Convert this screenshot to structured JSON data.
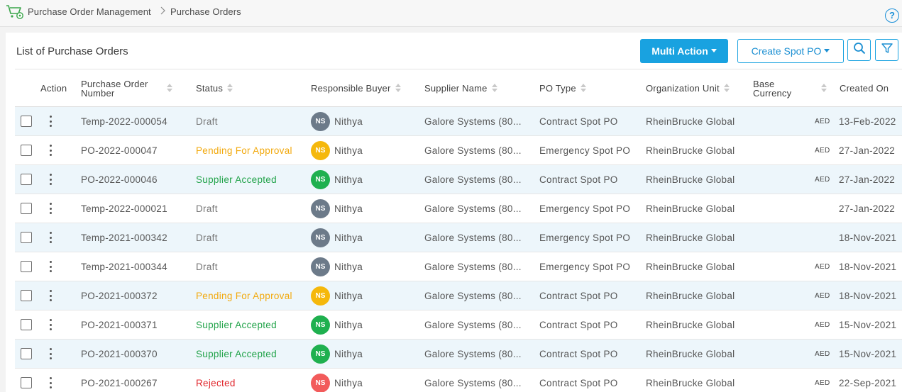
{
  "breadcrumb": {
    "root": "Purchase Order Management",
    "current": "Purchase Orders"
  },
  "help_label": "?",
  "panel": {
    "title": "List of Purchase Orders"
  },
  "toolbar": {
    "multi_action_label": "Multi Action",
    "create_spot_po_label": "Create Spot PO"
  },
  "colors": {
    "accent": "#19a2e0",
    "status_draft": "#777777",
    "status_pending": "#f2a90d",
    "status_accepted": "#22a34a",
    "status_rejected": "#e0252b",
    "avatar_gray": "#6c7a89",
    "avatar_yellow": "#f5b80c",
    "avatar_green": "#1fb04f",
    "avatar_red": "#f25b5b"
  },
  "table": {
    "columns": {
      "action": "Action",
      "po_number_line1": "Purchase Order",
      "po_number_line2": "Number",
      "status": "Status",
      "buyer": "Responsible Buyer",
      "supplier": "Supplier Name",
      "po_type": "PO Type",
      "org_unit": "Organization Unit",
      "base_currency_line1": "Base",
      "base_currency_line2": "Currency",
      "created_on": "Created On"
    },
    "rows": [
      {
        "po_number": "Temp-2022-000054",
        "status": "Draft",
        "status_kind": "draft",
        "buyer_initials": "NS",
        "buyer_name": "Nithya",
        "supplier": "Galore Systems (80...",
        "po_type": "Contract Spot PO",
        "org_unit": "RheinBrucke Global",
        "currency": "AED",
        "created_on": "13-Feb-2022"
      },
      {
        "po_number": "PO-2022-000047",
        "status": "Pending For Approval",
        "status_kind": "pending",
        "buyer_initials": "NS",
        "buyer_name": "Nithya",
        "supplier": "Galore Systems (80...",
        "po_type": "Emergency Spot PO",
        "org_unit": "RheinBrucke Global",
        "currency": "AED",
        "created_on": "27-Jan-2022"
      },
      {
        "po_number": "PO-2022-000046",
        "status": "Supplier Accepted",
        "status_kind": "accepted",
        "buyer_initials": "NS",
        "buyer_name": "Nithya",
        "supplier": "Galore Systems (80...",
        "po_type": "Contract Spot PO",
        "org_unit": "RheinBrucke Global",
        "currency": "AED",
        "created_on": "27-Jan-2022"
      },
      {
        "po_number": "Temp-2022-000021",
        "status": "Draft",
        "status_kind": "draft",
        "buyer_initials": "NS",
        "buyer_name": "Nithya",
        "supplier": "Galore Systems (80...",
        "po_type": "Emergency Spot PO",
        "org_unit": "RheinBrucke Global",
        "currency": "",
        "created_on": "27-Jan-2022"
      },
      {
        "po_number": "Temp-2021-000342",
        "status": "Draft",
        "status_kind": "draft",
        "buyer_initials": "NS",
        "buyer_name": "Nithya",
        "supplier": "Galore Systems (80...",
        "po_type": "Emergency Spot PO",
        "org_unit": "RheinBrucke Global",
        "currency": "",
        "created_on": "18-Nov-2021"
      },
      {
        "po_number": "Temp-2021-000344",
        "status": "Draft",
        "status_kind": "draft",
        "buyer_initials": "NS",
        "buyer_name": "Nithya",
        "supplier": "Galore Systems (80...",
        "po_type": "Emergency Spot PO",
        "org_unit": "RheinBrucke Global",
        "currency": "AED",
        "created_on": "18-Nov-2021"
      },
      {
        "po_number": "PO-2021-000372",
        "status": "Pending For Approval",
        "status_kind": "pending",
        "buyer_initials": "NS",
        "buyer_name": "Nithya",
        "supplier": "Galore Systems (80...",
        "po_type": "Contract Spot PO",
        "org_unit": "RheinBrucke Global",
        "currency": "AED",
        "created_on": "18-Nov-2021"
      },
      {
        "po_number": "PO-2021-000371",
        "status": "Supplier Accepted",
        "status_kind": "accepted",
        "buyer_initials": "NS",
        "buyer_name": "Nithya",
        "supplier": "Galore Systems (80...",
        "po_type": "Contract Spot PO",
        "org_unit": "RheinBrucke Global",
        "currency": "AED",
        "created_on": "15-Nov-2021"
      },
      {
        "po_number": "PO-2021-000370",
        "status": "Supplier Accepted",
        "status_kind": "accepted",
        "buyer_initials": "NS",
        "buyer_name": "Nithya",
        "supplier": "Galore Systems (80...",
        "po_type": "Contract Spot PO",
        "org_unit": "RheinBrucke Global",
        "currency": "AED",
        "created_on": "15-Nov-2021"
      },
      {
        "po_number": "PO-2021-000267",
        "status": "Rejected",
        "status_kind": "rejected",
        "buyer_initials": "NS",
        "buyer_name": "Nithya",
        "supplier": "Galore Systems (80...",
        "po_type": "Contract Spot PO",
        "org_unit": "RheinBrucke Global",
        "currency": "AED",
        "created_on": "22-Sep-2021"
      }
    ]
  }
}
